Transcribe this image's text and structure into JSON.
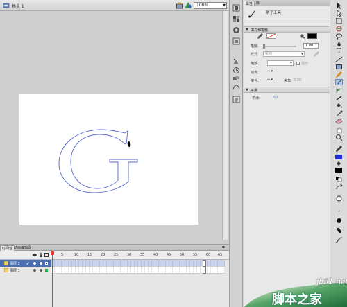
{
  "stage": {
    "scene_label": "场景 1",
    "zoom_value": "100%"
  },
  "timeline": {
    "tabs": [
      "时间轴",
      "动画编辑器"
    ],
    "frame_numbers": [
      "5",
      "10",
      "15",
      "20",
      "25",
      "30",
      "35",
      "40",
      "45",
      "50",
      "55",
      "60",
      "65"
    ],
    "layers": [
      {
        "name": "图层 2",
        "selected": true
      },
      {
        "name": "图层 1",
        "selected": false
      }
    ]
  },
  "properties": {
    "tabs": [
      "属性",
      "库"
    ],
    "tool_name": "刷子工具",
    "fill_stroke_section": "填充和笔触",
    "stroke_label": "笔触:",
    "stroke_value": "1.00",
    "style_label": "样式:",
    "style_value": "实线",
    "scale_label": "缩放:",
    "hint_label": "提示",
    "cap_label": "端点:",
    "join_label": "接合:",
    "miter_label": "尖角:",
    "miter_value": "3.00",
    "smooth_section": "平滑",
    "smooth_label": "平滑:",
    "smooth_value": "50"
  },
  "colors": {
    "stroke_color": "#1d2bd6",
    "fill_color": "#000000",
    "selected_layer": "#4a6fb5",
    "playhead": "#e33333"
  },
  "watermark": {
    "url": "jb51.net",
    "name": "脚本之家"
  }
}
